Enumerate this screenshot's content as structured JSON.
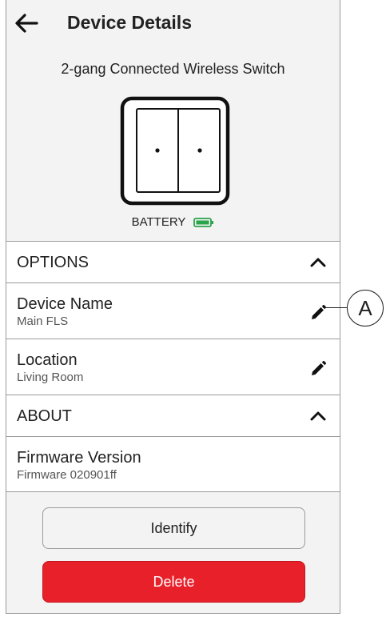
{
  "header": {
    "title": "Device Details",
    "back_icon": "arrow-left-icon"
  },
  "device": {
    "model": "2-gang Connected Wireless Switch",
    "battery_label": "BATTERY",
    "battery_color": "#2aa34a"
  },
  "options": {
    "label": "OPTIONS",
    "items": [
      {
        "label": "Device Name",
        "value": "Main FLS",
        "icon": "pencil-icon"
      },
      {
        "label": "Location",
        "value": "Living Room",
        "icon": "pencil-icon"
      }
    ]
  },
  "about": {
    "label": "ABOUT",
    "items": [
      {
        "label": "Firmware Version",
        "value": "Firmware 020901ff"
      }
    ]
  },
  "buttons": {
    "identify": "Identify",
    "delete": "Delete",
    "delete_color": "#e8202a"
  },
  "annotation": {
    "callout_label": "A"
  }
}
